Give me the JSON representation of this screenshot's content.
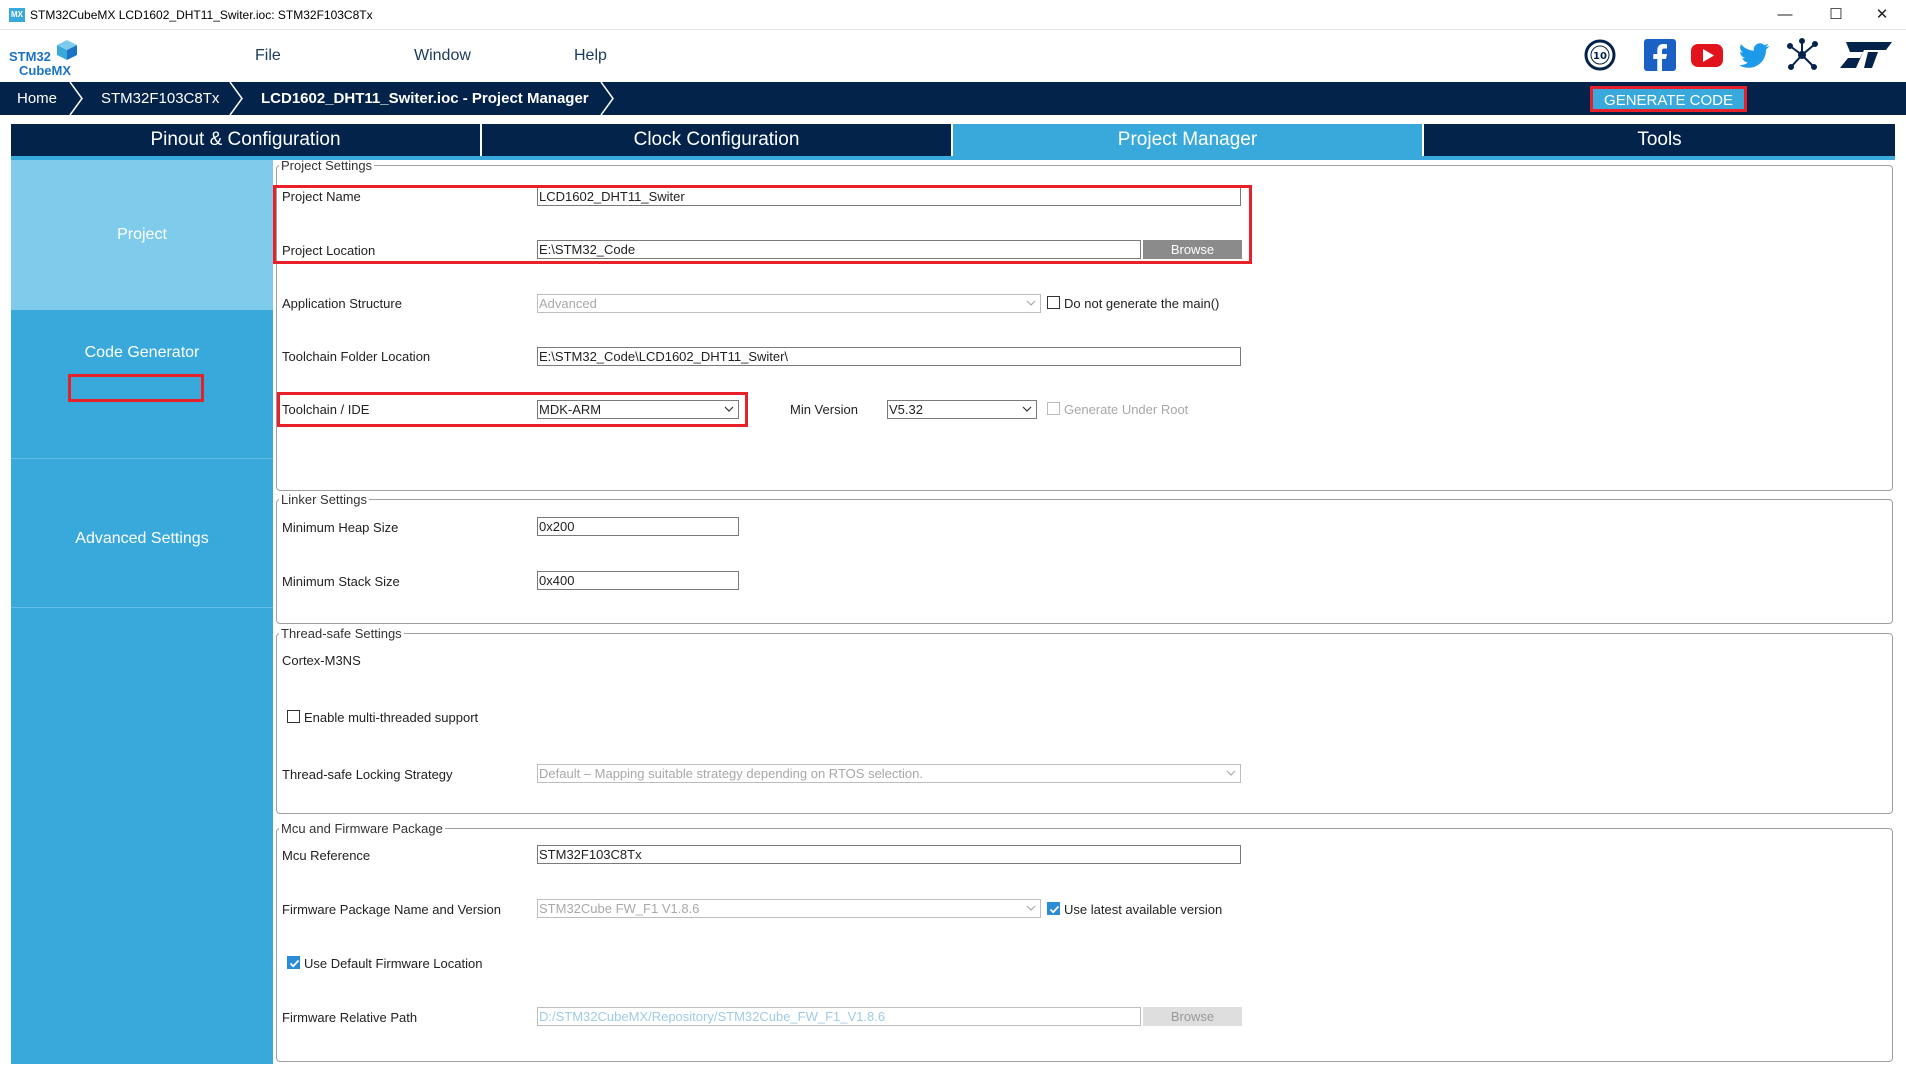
{
  "window": {
    "app_icon": "MX",
    "title": "STM32CubeMX LCD1602_DHT11_Switer.ioc: STM32F103C8Tx",
    "minimize": "—",
    "maximize": "☐",
    "close": "✕"
  },
  "logo": {
    "line1": "STM32",
    "line2": "CubeMX"
  },
  "menu": {
    "file": "File",
    "window": "Window",
    "help": "Help"
  },
  "social_icons": [
    "anniversary-10-icon",
    "facebook-icon",
    "youtube-icon",
    "twitter-icon",
    "network-icon",
    "st-logo-icon"
  ],
  "breadcrumb": {
    "home": "Home",
    "mcu": "STM32F103C8Tx",
    "current": "LCD1602_DHT11_Switer.ioc - Project Manager"
  },
  "generate_code": "GENERATE CODE",
  "tabs": [
    {
      "label": "Pinout & Configuration",
      "active": false
    },
    {
      "label": "Clock Configuration",
      "active": false
    },
    {
      "label": "Project Manager",
      "active": true
    },
    {
      "label": "Tools",
      "active": false
    }
  ],
  "sidebar": {
    "project": "Project",
    "code_generator": "Code Generator",
    "advanced_settings": "Advanced Settings"
  },
  "project_settings": {
    "legend": "Project Settings",
    "project_name_label": "Project Name",
    "project_name_value": "LCD1602_DHT11_Switer",
    "project_location_label": "Project Location",
    "project_location_value": "E:\\STM32_Code",
    "browse": "Browse",
    "app_structure_label": "Application Structure",
    "app_structure_value": "Advanced",
    "no_main_label": "Do not generate the main()",
    "toolchain_folder_label": "Toolchain Folder Location",
    "toolchain_folder_value": "E:\\STM32_Code\\LCD1602_DHT11_Switer\\",
    "toolchain_ide_label": "Toolchain / IDE",
    "toolchain_ide_value": "MDK-ARM",
    "min_version_label": "Min Version",
    "min_version_value": "V5.32",
    "generate_under_root": "Generate Under Root"
  },
  "linker_settings": {
    "legend": "Linker Settings",
    "heap_label": "Minimum Heap Size",
    "heap_value": "0x200",
    "stack_label": "Minimum Stack Size",
    "stack_value": "0x400"
  },
  "thread_safe": {
    "legend": "Thread-safe Settings",
    "core": "Cortex-M3NS",
    "multi_thread_label": "Enable multi-threaded support",
    "locking_label": "Thread-safe Locking Strategy",
    "locking_value": "Default  –  Mapping suitable strategy depending on RTOS selection."
  },
  "mcu_firmware": {
    "legend": "Mcu and Firmware Package",
    "mcu_ref_label": "Mcu Reference",
    "mcu_ref_value": "STM32F103C8Tx",
    "fw_name_label": "Firmware Package Name and Version",
    "fw_name_value": "STM32Cube FW_F1 V1.8.6",
    "use_latest_label": "Use latest available version",
    "use_default_label": "Use Default Firmware Location",
    "fw_path_label": "Firmware Relative Path",
    "fw_path_value": "D:/STM32CubeMX/Repository/STM32Cube_FW_F1_V1.8.6",
    "browse": "Browse"
  },
  "colors": {
    "navy": "#03234b",
    "accent": "#39a9dc",
    "sidebar_selected": "#7fcbec",
    "highlight": "#e8202a"
  }
}
